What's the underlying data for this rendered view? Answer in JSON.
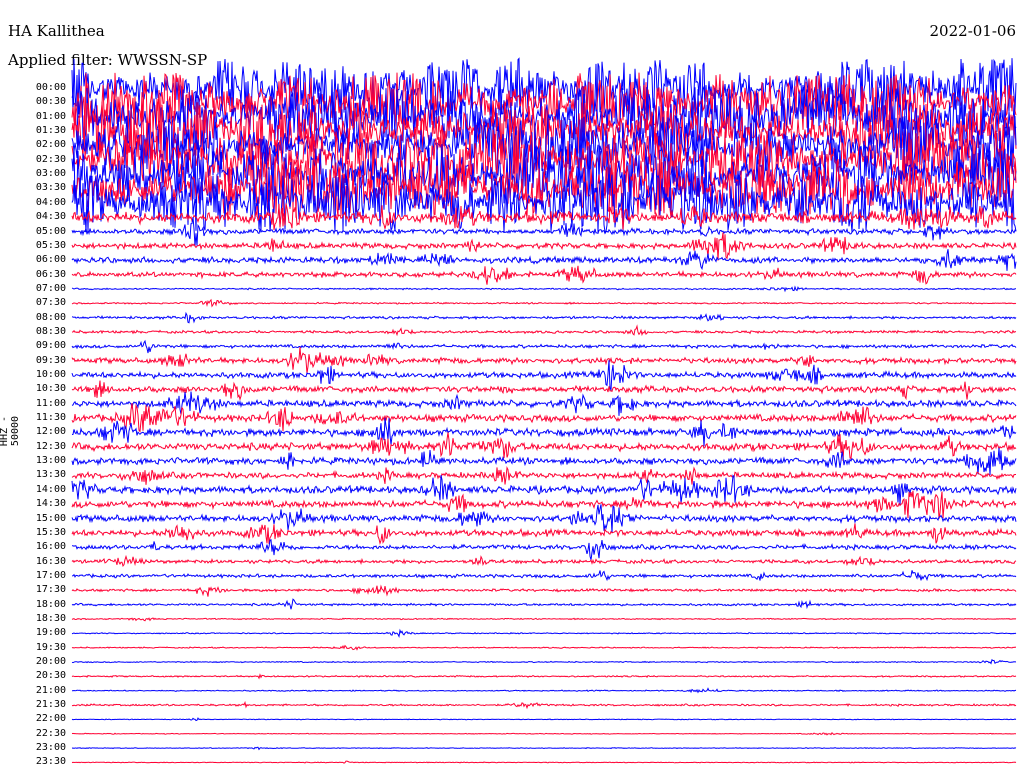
{
  "header": {
    "station": "HA Kallithea",
    "filter": "Applied filter: WWSSN-SP",
    "date": "2022-01-06",
    "channel_label": "HHZ - 50000"
  },
  "colors": {
    "odd": "#0000ff",
    "even": "#ff0033",
    "text": "#000000",
    "background": "#ffffff"
  },
  "chart_data": {
    "type": "line",
    "title": "HA Kallithea",
    "subtitle": "Applied filter: WWSSN-SP",
    "date": "2022-01-06",
    "ylabel": "HHZ - 50000",
    "xlabel": "",
    "trace_interval_minutes": 30,
    "row_labels": [
      "00:00",
      "00:30",
      "01:00",
      "01:30",
      "02:00",
      "02:30",
      "03:00",
      "03:30",
      "04:00",
      "04:30",
      "05:00",
      "05:30",
      "06:00",
      "06:30",
      "07:00",
      "07:30",
      "08:00",
      "08:30",
      "09:00",
      "09:30",
      "10:00",
      "10:30",
      "11:00",
      "11:30",
      "12:00",
      "12:30",
      "13:00",
      "13:30",
      "14:00",
      "14:30",
      "15:00",
      "15:30",
      "16:00",
      "16:30",
      "17:00",
      "17:30",
      "18:00",
      "18:30",
      "19:00",
      "19:30",
      "20:00",
      "20:30",
      "21:00",
      "21:30",
      "22:00",
      "22:30",
      "23:00",
      "23:30"
    ],
    "trace_colors": [
      "#0000ff",
      "#ff0033"
    ],
    "relative_activity": [
      9,
      9,
      9,
      9,
      9,
      9,
      9,
      9,
      9,
      3,
      1.5,
      1.5,
      1.6,
      1.4,
      0.4,
      0.4,
      0.7,
      0.7,
      0.9,
      1.5,
      1.6,
      1.7,
      1.8,
      1.9,
      2.0,
      2.0,
      1.8,
      1.6,
      2.0,
      1.9,
      1.8,
      1.7,
      1.2,
      1.0,
      0.9,
      0.7,
      0.6,
      0.3,
      0.3,
      0.3,
      0.3,
      0.4,
      0.3,
      0.5,
      0.2,
      0.2,
      0.2,
      0.2
    ],
    "grid": false
  }
}
